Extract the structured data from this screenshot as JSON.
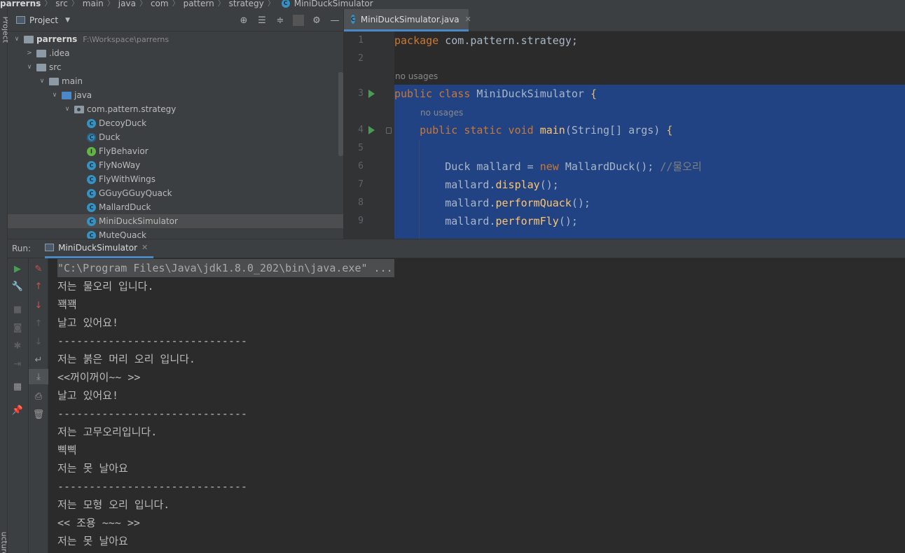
{
  "breadcrumb": [
    "parrerns",
    "src",
    "main",
    "java",
    "com",
    "pattern",
    "strategy",
    "MiniDuckSimulator"
  ],
  "sidebar": {
    "project_label": "Project",
    "structure_label": "ucture"
  },
  "project_panel": {
    "title": "Project",
    "header_icons": [
      "locate-icon",
      "expand-all-icon",
      "collapse-all-icon",
      "settings-icon",
      "minimize-icon"
    ],
    "tree": [
      {
        "label": "parrerns",
        "hint": "F:\\Workspace\\parrerns",
        "depth": 0,
        "arrow": "open",
        "icon": "folder"
      },
      {
        "label": ".idea",
        "depth": 1,
        "arrow": "closed",
        "icon": "folder"
      },
      {
        "label": "src",
        "depth": 1,
        "arrow": "open",
        "icon": "folder"
      },
      {
        "label": "main",
        "depth": 2,
        "arrow": "open",
        "icon": "folder"
      },
      {
        "label": "java",
        "depth": 3,
        "arrow": "open",
        "icon": "folder-blue"
      },
      {
        "label": "com.pattern.strategy",
        "depth": 4,
        "arrow": "open",
        "icon": "package"
      },
      {
        "label": "DecoyDuck",
        "depth": 5,
        "icon": "class"
      },
      {
        "label": "Duck",
        "depth": 5,
        "icon": "abstract-class"
      },
      {
        "label": "FlyBehavior",
        "depth": 5,
        "icon": "interface"
      },
      {
        "label": "FlyNoWay",
        "depth": 5,
        "icon": "class"
      },
      {
        "label": "FlyWithWings",
        "depth": 5,
        "icon": "class"
      },
      {
        "label": "GGuyGGuyQuack",
        "depth": 5,
        "icon": "class"
      },
      {
        "label": "MallardDuck",
        "depth": 5,
        "icon": "class"
      },
      {
        "label": "MiniDuckSimulator",
        "depth": 5,
        "icon": "class",
        "selected": true
      },
      {
        "label": "MuteQuack",
        "depth": 5,
        "icon": "class"
      }
    ]
  },
  "editor": {
    "tab_label": "MiniDuckSimulator.java",
    "hint_no_usages": "no usages",
    "lines": [
      {
        "n": "1",
        "parts": [
          [
            "kw",
            "package"
          ],
          [
            "pkg",
            " com.pattern.strategy;"
          ]
        ]
      },
      {
        "n": "2",
        "parts": []
      },
      {
        "n": "3",
        "parts": [
          [
            "kw",
            "public class "
          ],
          [
            "cls-n",
            "MiniDuckSimulator "
          ],
          [
            "br",
            "{"
          ]
        ]
      },
      {
        "n": "4",
        "parts": [
          [
            "kw",
            "    public static void "
          ],
          [
            "fn",
            "main"
          ],
          [
            "ty",
            "(String[] args) "
          ],
          [
            "br",
            "{"
          ]
        ]
      },
      {
        "n": "5",
        "parts": []
      },
      {
        "n": "6",
        "parts": [
          [
            "ty",
            "        Duck mallard = "
          ],
          [
            "kw",
            "new "
          ],
          [
            "ty",
            "MallardDuck(); "
          ],
          [
            "cm",
            "//물오리"
          ]
        ]
      },
      {
        "n": "7",
        "parts": [
          [
            "ty",
            "        mallard."
          ],
          [
            "fn",
            "display"
          ],
          [
            "ty",
            "();"
          ]
        ]
      },
      {
        "n": "8",
        "parts": [
          [
            "ty",
            "        mallard."
          ],
          [
            "fn",
            "performQuack"
          ],
          [
            "ty",
            "();"
          ]
        ]
      },
      {
        "n": "9",
        "parts": [
          [
            "ty",
            "        mallard."
          ],
          [
            "fn",
            "performFly"
          ],
          [
            "ty",
            "();"
          ]
        ]
      }
    ]
  },
  "run": {
    "label": "Run:",
    "tab_label": "MiniDuckSimulator",
    "console": [
      "\"C:\\Program Files\\Java\\jdk1.8.0_202\\bin\\java.exe\" ...",
      "저는 물오리 입니다.",
      "꽥꽥",
      "날고 있어요!",
      "------------------------------",
      "저는 붉은 머리 오리 입니다.",
      "<<꺼이꺼이~~ >>",
      "날고 있어요!",
      "------------------------------",
      "저는 고무오리입니다.",
      "삑삑",
      "저는 못 날아요",
      "------------------------------",
      "저는 모형 오리 입니다.",
      "<< 조용 ~~~ >>",
      "저는 못 날아요"
    ]
  },
  "colors": {
    "keyword": "#cc7832",
    "class_icon": "#3592c4",
    "interface_icon": "#62b543",
    "run_green": "#499c54",
    "selection": "#214283"
  }
}
